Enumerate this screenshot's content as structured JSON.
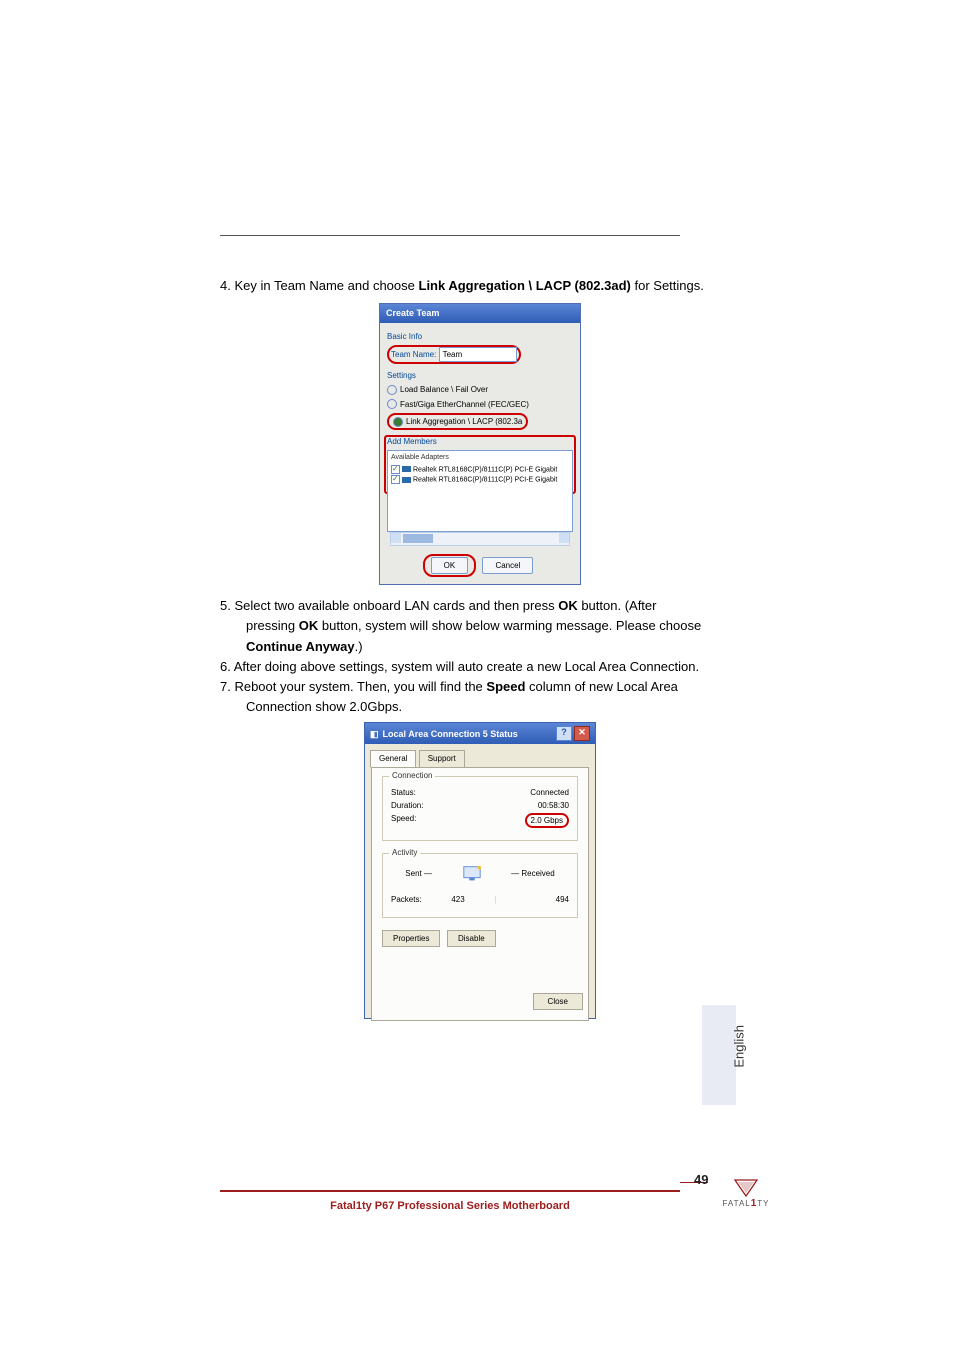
{
  "step4": {
    "prefix": "4. Key in Team Name and choose ",
    "bold": "Link Aggregation \\ LACP (802.3ad)",
    "suffix": " for Settings."
  },
  "create_team": {
    "title": "Create Team",
    "section_basic": "Basic Info",
    "team_name_label": "Team Name:",
    "team_name_value": "Team",
    "section_settings": "Settings",
    "radio1": "Load Balance \\ Fail Over",
    "radio2": "Fast/Giga EtherChannel (FEC/GEC)",
    "radio3": "Link Aggregation \\ LACP (802.3a",
    "section_members": "Add Members",
    "available": "Available Adapters",
    "adapter1": "Realtek RTL8168C(P)/8111C(P) PCI-E Gigabit",
    "adapter2": "Realtek RTL8168C(P)/8111C(P) PCI-E Gigabit",
    "ok": "OK",
    "cancel": "Cancel"
  },
  "step5": {
    "line1a": "5. Select two available onboard LAN cards and then press ",
    "ok": "OK",
    "line1b": " button. (After",
    "line2a": "pressing ",
    "line2b": " button, system will show below warming message. Please choose",
    "line3a": "Continue Anyway",
    "line3b": ".)"
  },
  "step6": "6. After doing above settings, system will auto create a new Local Area Connection.",
  "step7": {
    "a": "7. Reboot your system. Then, you will find the ",
    "speed": "Speed",
    "b": " column of new Local Area",
    "c": "Connection show 2.0Gbps."
  },
  "status": {
    "title": "Local Area Connection 5 Status",
    "tab_general": "General",
    "tab_support": "Support",
    "group_conn": "Connection",
    "row_status_l": "Status:",
    "row_status_v": "Connected",
    "row_duration_l": "Duration:",
    "row_duration_v": "00:58:30",
    "row_speed_l": "Speed:",
    "row_speed_v": "2.0 Gbps",
    "group_act": "Activity",
    "sent": "Sent",
    "recv": "Received",
    "packets_l": "Packets:",
    "packets_sent": "423",
    "packets_recv": "494",
    "btn_props": "Properties",
    "btn_disable": "Disable",
    "btn_close": "Close"
  },
  "lang": "English",
  "page_number": "49",
  "footer": "Fatal1ty P67 Professional Series Motherboard",
  "brand": {
    "line1": "FATAL",
    "accent": "1",
    "line2": "TY"
  }
}
